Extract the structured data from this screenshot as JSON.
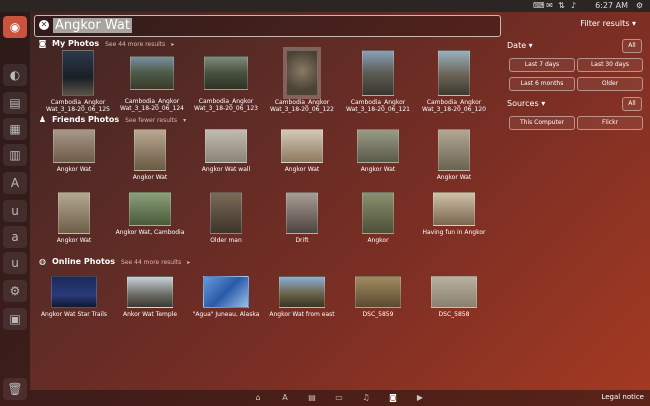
{
  "topbar": {
    "time": "6:27 AM"
  },
  "search": {
    "query": "Angkor Wat"
  },
  "filters": {
    "title": "Filter results",
    "date": {
      "label": "Date",
      "all": "All",
      "options": [
        "Last 7 days",
        "Last 30 days",
        "Last 6 months",
        "Older"
      ]
    },
    "sources": {
      "label": "Sources",
      "all": "All",
      "options": [
        "This Computer",
        "Flickr"
      ]
    }
  },
  "sections": {
    "my_photos": {
      "title": "My Photos",
      "more": "See 44 more results",
      "items": [
        "Cambodia_Angkor Wat_3_18-20_06_125",
        "Cambodia_Angkor Wat_3_18-20_06_124",
        "Cambodia_Angkor Wat_3_18-20_06_123",
        "Cambodia_Angkor Wat_3_18-20_06_122",
        "Cambodia_Angkor Wat_3_18-20_06_121",
        "Cambodia_Angkor Wat_3_18-20_06_120"
      ]
    },
    "friends_photos": {
      "title": "Friends Photos",
      "more": "See fewer results",
      "row1": [
        "Angkor Wat",
        "Angkor Wat",
        "Angkor Wat wall",
        "Angkor Wat",
        "Angkor Wat",
        "Angkor Wat"
      ],
      "row2": [
        "Angkor Wat",
        "Angkor Wat, Cambodia",
        "Older man",
        "Drift",
        "Angkor",
        "Having fun in Angkor"
      ]
    },
    "online_photos": {
      "title": "Online Photos",
      "more": "See 44 more results",
      "items": [
        "Angkor Wat Star Trails",
        "Ankor Wat Temple",
        "\"Agua\" Juneau, Alaska",
        "Angkor Wat from east",
        "DSC_5859",
        "DSC_5858"
      ]
    }
  },
  "dock": {
    "legal": "Legal notice"
  },
  "colors": {
    "accent": "#c9533c",
    "bg": "#7a2e24"
  }
}
